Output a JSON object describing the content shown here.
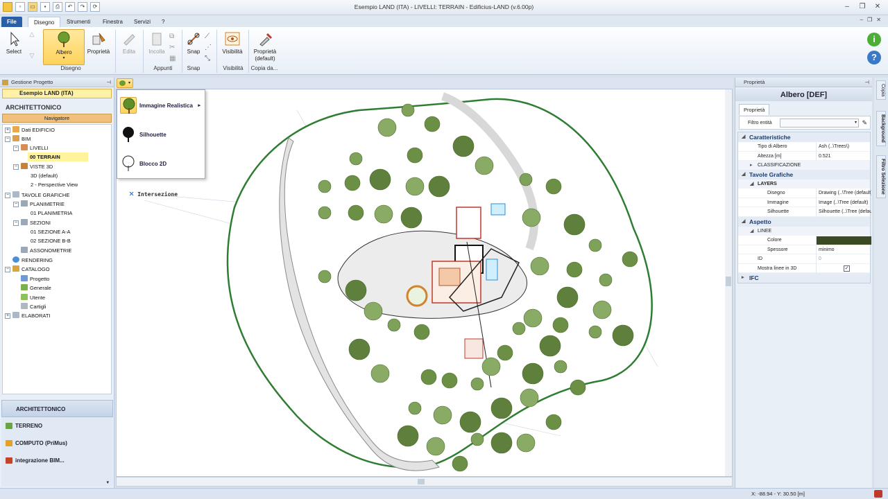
{
  "window": {
    "title": "Esempio LAND (ITA)  -  LIVELLI: TERRAIN - Edificius-LAND (v.6.00p)"
  },
  "tabs": [
    "File",
    "Disegno",
    "Strumenti",
    "Finestra",
    "Servizi",
    "?"
  ],
  "ribbon": {
    "select": "Select",
    "albero": "Albero",
    "proprieta": "Proprietà",
    "edita": "Edita",
    "incolla": "Incolla",
    "snap": "Snap",
    "visibilita": "Visibilità",
    "proprieta_default": "Proprietà\n(default)",
    "groups": {
      "disegno": "Disegno",
      "appunti": "Appunti",
      "snap": "Snap",
      "visibilita": "Visibilità",
      "copia": "Copia da..."
    }
  },
  "left": {
    "panel_title": "Gestione Progetto",
    "project": "Esempio LAND (ITA)",
    "section": "ARCHITETTONICO",
    "navigator": "Navigatore",
    "tree": [
      "Dati EDIFICIO",
      "BIM",
      "LIVELLI",
      "00 TERRAIN",
      "VISTE 3D",
      "3D (default)",
      "2 - Perspective View",
      "TAVOLE GRAFICHE",
      "PLANIMETRIE",
      "01 PLANIMETRIA",
      "SEZIONI",
      "01 SEZIONE  A-A",
      "02 SEZIONE  B-B",
      "ASSONOMETRIE",
      "RENDERING",
      "CATALOGO",
      "Progetto",
      "Generale",
      "Utente",
      "Cartigli",
      "ELABORATI"
    ],
    "modules": [
      "ARCHITETTONICO",
      "TERRENO",
      "COMPUTO (PriMus)",
      "integrazione BIM..."
    ]
  },
  "popup": [
    "Immagine Realistica",
    "Silhouette",
    "Blocco 2D"
  ],
  "canvas": {
    "snap_label": "Intersezione"
  },
  "right": {
    "panel_title": "Proprietà",
    "object": "Albero [DEF]",
    "tab": "Proprietà",
    "filter_label": "Filtro entità",
    "cat1": "Caratteristiche",
    "tipo_k": "Tipo di Albero",
    "tipo_v": "Ash    (..\\Trees\\)",
    "alt_k": "Altezza  [m]",
    "alt_v": "0.521",
    "class": "CLASSIFICAZIONE",
    "cat2": "Tavole Grafiche",
    "layers": "LAYERS",
    "dis_k": "Disegno",
    "dis_v": "Drawing    (..\\Tree (default)",
    "img_k": "Immagine",
    "img_v": "Image    (..\\Tree (default)",
    "sil_k": "Silhouette",
    "sil_v": "Silhouette    (..\\Tree (default)",
    "cat3": "Aspetto",
    "linee": "LINEE",
    "col_k": "Colore",
    "spes_k": "Spessore",
    "spes_v": "minimo",
    "id_k": "ID",
    "id_v": "0",
    "ml_k": "Mostra linee in 3D",
    "cat4": "IFC",
    "line_color": "#3a4a22"
  },
  "sidetabs": [
    "Copia",
    "Background",
    "Filtro Selezione"
  ],
  "status": {
    "coords": "X: -88.94 - Y: 30.50 [m]"
  }
}
